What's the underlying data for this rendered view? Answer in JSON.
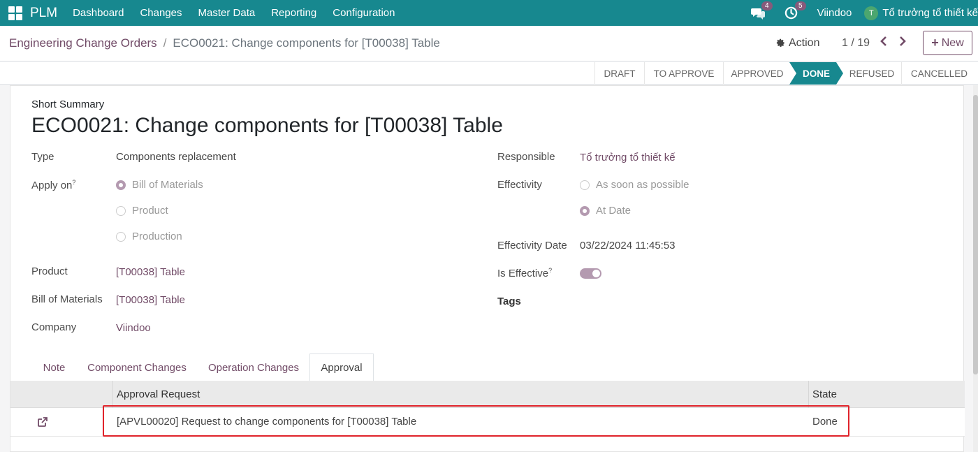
{
  "topbar": {
    "brand": "PLM",
    "nav": [
      "Dashboard",
      "Changes",
      "Master Data",
      "Reporting",
      "Configuration"
    ],
    "messages_count": "4",
    "activities_count": "5",
    "company": "Viindoo",
    "avatar_initial": "T",
    "user": "Tổ trưởng tổ thiết kế"
  },
  "control": {
    "breadcrumb_parent": "Engineering Change Orders",
    "breadcrumb_separator": "/",
    "breadcrumb_current": "ECO0021: Change components for [T00038] Table",
    "action_label": "Action",
    "pager": "1 / 19",
    "new_label": "New"
  },
  "stages": [
    "DRAFT",
    "TO APPROVE",
    "APPROVED",
    "DONE",
    "REFUSED",
    "CANCELLED"
  ],
  "active_stage": "DONE",
  "form": {
    "short_summary_label": "Short Summary",
    "title": "ECO0021: Change components for [T00038] Table",
    "type_label": "Type",
    "type_value": "Components replacement",
    "apply_on_label": "Apply on",
    "help_mark": "?",
    "apply_on_options": [
      "Bill of Materials",
      "Product",
      "Production"
    ],
    "product_label": "Product",
    "product_value": "[T00038] Table",
    "bom_label": "Bill of Materials",
    "bom_value": "[T00038] Table",
    "company_label": "Company",
    "company_value": "Viindoo",
    "responsible_label": "Responsible",
    "responsible_value": "Tổ trưởng tổ thiết kế",
    "effectivity_label": "Effectivity",
    "effectivity_options": [
      "As soon as possible",
      "At Date"
    ],
    "effectivity_date_label": "Effectivity Date",
    "effectivity_date_value": "03/22/2024 11:45:53",
    "is_effective_label": "Is Effective",
    "tags_label": "Tags"
  },
  "tabs": [
    "Note",
    "Component Changes",
    "Operation Changes",
    "Approval"
  ],
  "table": {
    "headers": [
      "Approval Request",
      "State"
    ],
    "rows": [
      {
        "request": "[APVL00020] Request to change components for [T00038] Table",
        "state": "Done"
      }
    ]
  },
  "colors": {
    "primary": "#17888f",
    "link": "#714b67",
    "highlight": "#e0232a"
  }
}
